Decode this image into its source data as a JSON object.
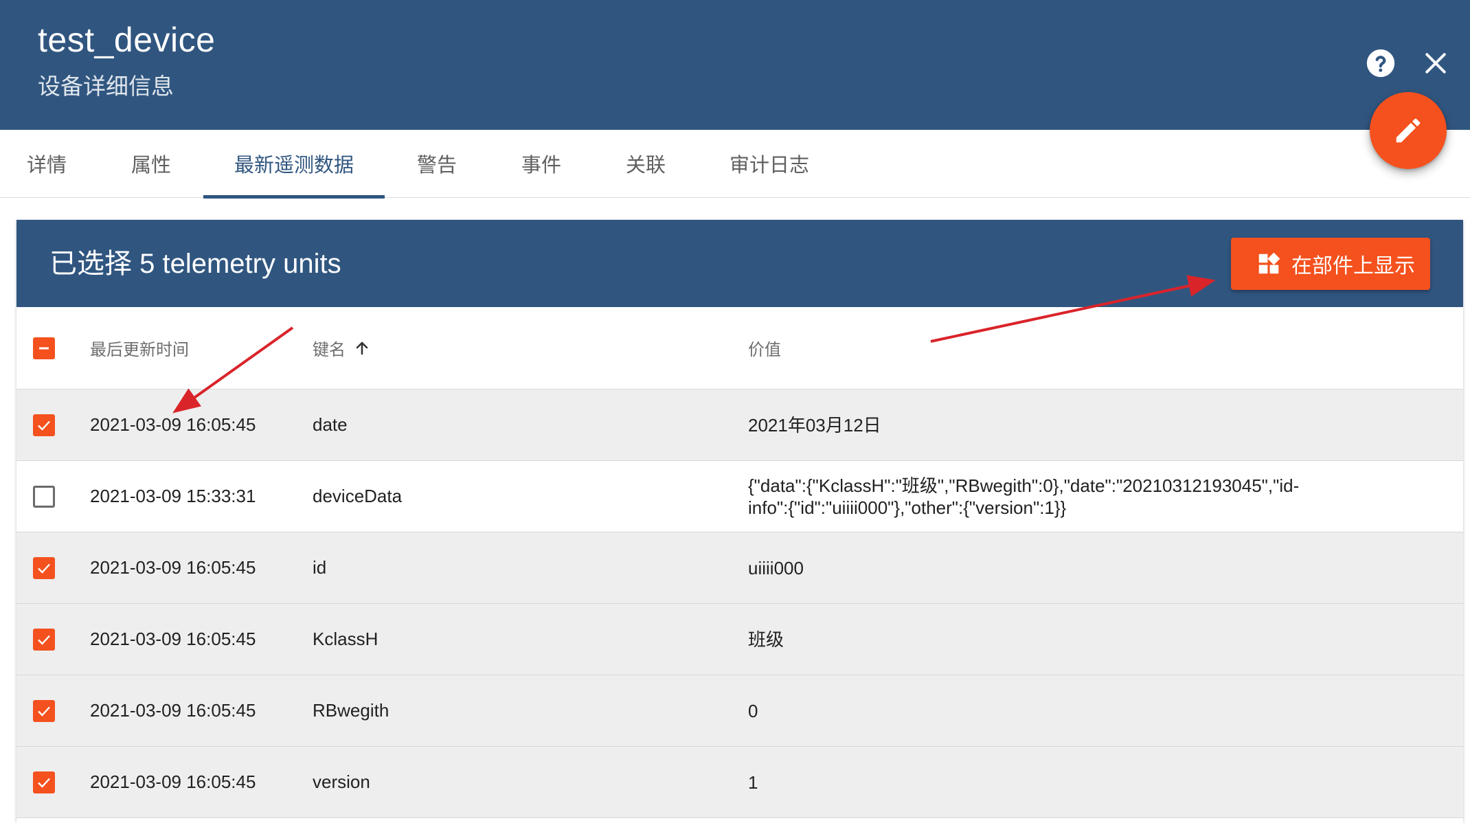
{
  "header": {
    "title": "test_device",
    "subtitle": "设备详细信息"
  },
  "icons": {
    "help": "help-circle-icon",
    "close": "close-icon",
    "edit": "pencil-icon",
    "widget": "widgets-icon",
    "sort": "arrow-up-icon"
  },
  "tabs": [
    {
      "label": "详情"
    },
    {
      "label": "属性"
    },
    {
      "label": "最新遥测数据",
      "active": true
    },
    {
      "label": "警告"
    },
    {
      "label": "事件"
    },
    {
      "label": "关联"
    },
    {
      "label": "审计日志"
    }
  ],
  "toolbar": {
    "selection_text": "已选择 5 telemetry units",
    "show_on_widget_label": "在部件上显示"
  },
  "table": {
    "columns": {
      "last_update": "最后更新时间",
      "key": "键名",
      "value": "价值"
    },
    "rows": [
      {
        "time": "2021-03-09 16:05:45",
        "key": "date",
        "value": "2021年03月12日",
        "selected": true
      },
      {
        "time": "2021-03-09 15:33:31",
        "key": "deviceData",
        "value": "{\"data\":{\"KclassH\":\"班级\",\"RBwegith\":0},\"date\":\"20210312193045\",\"id-info\":{\"id\":\"uiiii000\"},\"other\":{\"version\":1}}",
        "selected": false
      },
      {
        "time": "2021-03-09 16:05:45",
        "key": "id",
        "value": "uiiii000",
        "selected": true
      },
      {
        "time": "2021-03-09 16:05:45",
        "key": "KclassH",
        "value": "班级",
        "selected": true
      },
      {
        "time": "2021-03-09 16:05:45",
        "key": "RBwegith",
        "value": "0",
        "selected": true
      },
      {
        "time": "2021-03-09 16:05:45",
        "key": "version",
        "value": "1",
        "selected": true
      }
    ]
  },
  "colors": {
    "primary": "#305680",
    "accent": "#f4511e",
    "annotation_arrow": "#d9242a"
  }
}
